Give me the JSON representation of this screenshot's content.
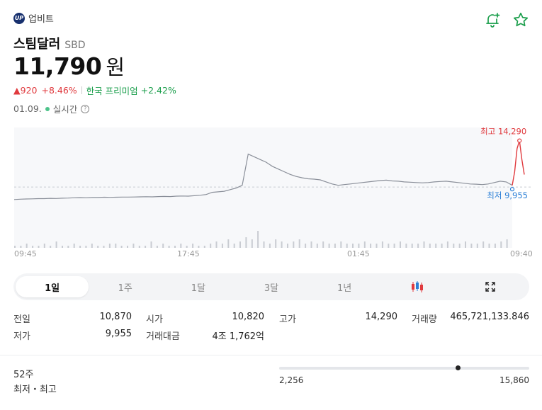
{
  "exchange": {
    "logo_text": "UP",
    "name": "업비트"
  },
  "asset": {
    "name": "스팀달러",
    "ticker": "SBD"
  },
  "price": {
    "value": "11,790",
    "unit": "원"
  },
  "change": {
    "amount": "▲920",
    "percent": "+8.46%",
    "premium_label": "한국 프리미엄",
    "premium_value": "+2.42%"
  },
  "timebar": {
    "date": "01.09.",
    "live_label": "실시간",
    "help": "?"
  },
  "chart_data": {
    "type": "line",
    "x_tick_labels": [
      "09:45",
      "17:45",
      "01:45",
      "09:40"
    ],
    "high_label": "최고 14,290",
    "low_label": "최저 9,955",
    "high": 14290,
    "low": 9955,
    "ylim": [
      9000,
      15000
    ],
    "reference_value": 10870,
    "price_series": [
      9950,
      9975,
      9990,
      10000,
      10020,
      10020,
      10040,
      10030,
      10050,
      10060,
      10080,
      10090,
      10080,
      10100,
      10100,
      10120,
      10110,
      10120,
      10130,
      10130,
      10140,
      10150,
      10160,
      10150,
      10170,
      10180,
      10170,
      10200,
      10210,
      10200,
      10230,
      10270,
      10320,
      10480,
      10520,
      10560,
      10680,
      10800,
      11000,
      13300,
      13100,
      12900,
      12700,
      12400,
      12200,
      12000,
      11800,
      11650,
      11550,
      11480,
      11450,
      11400,
      11250,
      11100,
      11000,
      11050,
      11100,
      11150,
      11200,
      11250,
      11300,
      11350,
      11380,
      11320,
      11300,
      11250,
      11230,
      11200,
      11180,
      11200,
      11250,
      11280,
      11300,
      11250,
      11200,
      11150,
      11100,
      11080,
      11050,
      11100,
      11200,
      11300,
      11250,
      11000
    ],
    "final_series": [
      11000,
      12000,
      13700,
      14290,
      12900,
      11790
    ],
    "volume_series": [
      1,
      1,
      2,
      1,
      1,
      2,
      1,
      3,
      1,
      1,
      2,
      1,
      1,
      2,
      1,
      1,
      2,
      2,
      1,
      1,
      2,
      1,
      1,
      3,
      1,
      2,
      1,
      1,
      2,
      1,
      2,
      1,
      1,
      2,
      3,
      2,
      4,
      2,
      3,
      5,
      4,
      8,
      3,
      2,
      4,
      3,
      2,
      3,
      4,
      2,
      3,
      2,
      3,
      2,
      2,
      3,
      2,
      2,
      2,
      3,
      2,
      2,
      3,
      2,
      2,
      3,
      2,
      2,
      2,
      3,
      2,
      2,
      2,
      3,
      2,
      2,
      3,
      2,
      2,
      3,
      2,
      2,
      3,
      4
    ]
  },
  "tabs": [
    {
      "label": "1일",
      "active": true
    },
    {
      "label": "1주",
      "active": false
    },
    {
      "label": "1달",
      "active": false
    },
    {
      "label": "3달",
      "active": false
    },
    {
      "label": "1년",
      "active": false
    }
  ],
  "stats": {
    "prev_close": {
      "label": "전일",
      "value": "10,870"
    },
    "open": {
      "label": "시가",
      "value": "10,820"
    },
    "high": {
      "label": "고가",
      "value": "14,290"
    },
    "volume": {
      "label": "거래량",
      "value": "465,721,133.846"
    },
    "low": {
      "label": "저가",
      "value": "9,955"
    },
    "turnover": {
      "label": "거래대금",
      "value": "4조 1,762억"
    }
  },
  "week52": {
    "label_top": "52주",
    "label_bottom": "최저・최고",
    "min": "2,256",
    "max": "15,860",
    "current_ratio": 0.7157
  },
  "colors": {
    "up": "#e03a3e",
    "down_blue": "#2b7fd6",
    "premium_green": "#1a9e4b",
    "line": "#8a8f99"
  }
}
